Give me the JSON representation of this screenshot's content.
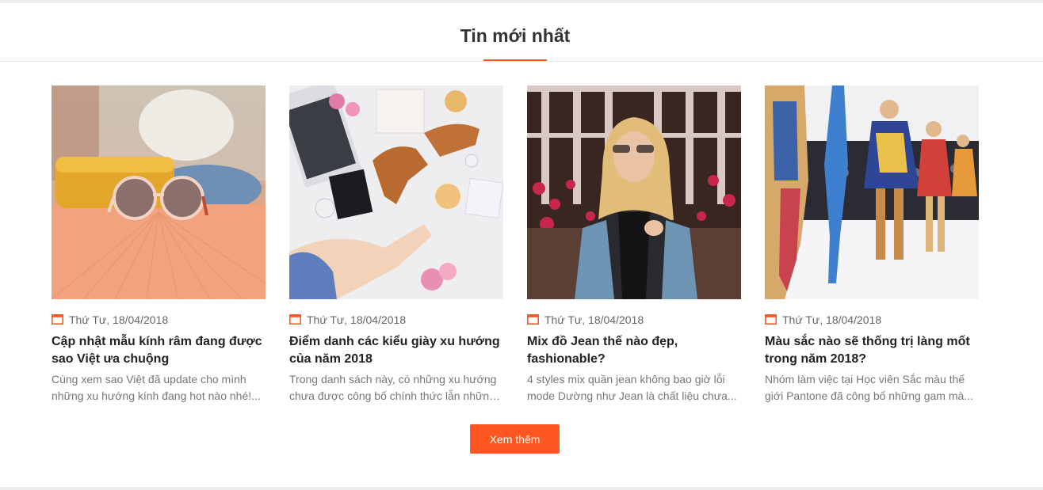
{
  "section": {
    "title": "Tin mới nhất"
  },
  "colors": {
    "accent": "#ff5722",
    "title": "#222222",
    "muted": "#777777"
  },
  "articles": [
    {
      "image_icon": "sunglasses-photo",
      "date": "Thứ Tư, 18/04/2018",
      "title_line1": "Cập nhật mẫu kính râm đang được",
      "title_line2": "sao Việt ưa chuộng",
      "desc_line1": "Cùng xem sao Việt đã update cho mình",
      "desc_line2": "những xu hướng kính đang hot nào nhé!..."
    },
    {
      "image_icon": "flatlay-photo",
      "date": "Thứ Tư, 18/04/2018",
      "title_line1": "Điểm danh các kiểu giày xu hướng",
      "title_line2": "của năm 2018",
      "desc_line1": "Trong danh sách này, có những xu hướng",
      "desc_line2": "chưa được công bố chính thức lẫn những..."
    },
    {
      "image_icon": "woman-jacket-photo",
      "date": "Thứ Tư, 18/04/2018",
      "title_line1": "Mix đồ Jean thế nào đẹp,",
      "title_line2": "fashionable?",
      "desc_line1": "4 styles mix quần jean không bao giờ lỗi",
      "desc_line2": "mode Dường như Jean là chất liệu chưa..."
    },
    {
      "image_icon": "runway-photo",
      "date": "Thứ Tư, 18/04/2018",
      "title_line1": "Màu sắc nào sẽ thống trị làng mốt",
      "title_line2": "trong năm 2018?",
      "desc_line1": "Nhóm làm việc tại Học viên Sắc màu thế",
      "desc_line2": "giới Pantone đã công bố những gam mà..."
    }
  ],
  "more_button": {
    "label": "Xem thêm"
  }
}
